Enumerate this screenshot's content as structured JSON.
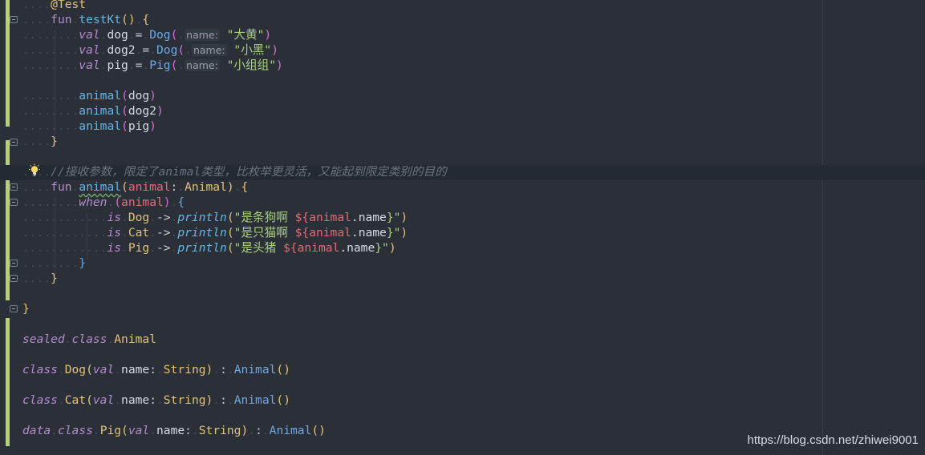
{
  "editor": {
    "lines": {
      "l0": "@Test",
      "l1_kw": "fun",
      "l1_name": "testKt",
      "dog_val": "val",
      "dog_id": "dog",
      "dog_type": "Dog",
      "hint_name": "name:",
      "dog_str": "\"大黄\"",
      "dog2_id": "dog2",
      "dog2_str": "\"小黑\"",
      "pig_id": "pig",
      "pig_type": "Pig",
      "pig_str": "\"小组组\"",
      "call_fn": "animal",
      "arg_dog": "dog",
      "arg_dog2": "dog2",
      "arg_pig": "pig",
      "comment": "//接收参数，限定了animal类型，比枚举更灵活，又能起到限定类别的目的",
      "f2_kw": "fun",
      "f2_name": "animal",
      "f2_param": "animal",
      "f2_ptype": "Animal",
      "when_kw": "when",
      "when_arg": "animal",
      "is_kw": "is",
      "cat_type": "Cat",
      "println": "println",
      "str_dog_pre": "\"是条狗啊 ",
      "str_cat_pre": "\"是只猫啊 ",
      "str_pig_pre": "\"是头猪 ",
      "tmpl_open": "${",
      "tmpl_var": "animal",
      "tmpl_prop": ".name",
      "tmpl_close": "}\"",
      "sealed_kw": "sealed",
      "class_kw": "class",
      "data_kw": "data",
      "animal_type": "Animal",
      "name_param": "name",
      "string_type": "String"
    }
  },
  "watermark": "https://blog.csdn.net/zhiwei9001"
}
